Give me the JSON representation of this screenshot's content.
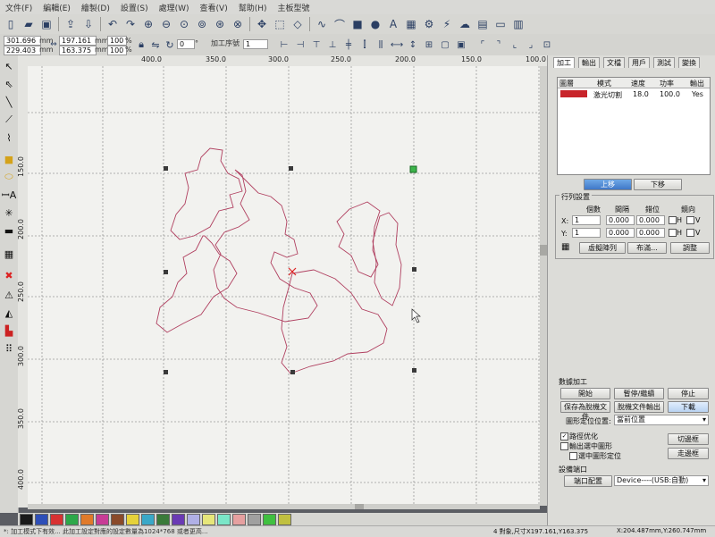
{
  "menu": [
    "文件(F)",
    "編輯(E)",
    "繪製(D)",
    "設置(S)",
    "處理(W)",
    "查看(V)",
    "幫助(H)",
    "主板型號"
  ],
  "toolbar2": {
    "pos_x": "301.696",
    "pos_y": "229.403",
    "unit_mm": "mm",
    "size_w": "197.161",
    "size_h": "163.375",
    "scale_x": "100",
    "scale_y": "100",
    "percent": "%",
    "angle": "0",
    "degree": "°",
    "order_label": "加工序號",
    "order_value": "1"
  },
  "ruler": {
    "h_ticks": [
      "400.0",
      "350.0",
      "300.0",
      "250.0",
      "200.0",
      "150.0",
      "100.0"
    ],
    "v_ticks": [
      "150.0",
      "200.0",
      "250.0",
      "300.0",
      "350.0",
      "400.0"
    ]
  },
  "palette": [
    "#1a1a1a",
    "#2e4fb8",
    "#d83232",
    "#2da84a",
    "#e07a2a",
    "#c83c96",
    "#8a4a2a",
    "#e6d23a",
    "#3aa8c8",
    "#3a7a3a",
    "#6a3ab4",
    "#b0b0e6",
    "#e6e67a",
    "#7ae6c8",
    "#e6a0a0",
    "#a0a0a0",
    "#40c040",
    "#c0c040"
  ],
  "status": {
    "left": "*: 加工模式下有效...  此加工設定對應的設定數量為1024*768 或者更高...",
    "right": "4 對象,尺寸X197.161,Y163.375",
    "coords": "X:204.487mm,Y:260.747mm"
  },
  "panel": {
    "tabs": [
      "加工",
      "輸出",
      "文檔",
      "用戶",
      "測試",
      "變換"
    ],
    "layer_headers": [
      "圖層",
      "模式",
      "速度",
      "功率",
      "輸出"
    ],
    "layer_rows": [
      {
        "color": "#c8242a",
        "mode": "激光切割",
        "speed": "18.0",
        "power": "100.0",
        "output": "Yes"
      }
    ],
    "btn_up": "上移",
    "btn_down": "下移",
    "array_title": "行列設置",
    "array_headers": [
      "個數",
      "間隔",
      "錯位",
      "鏡向"
    ],
    "row_x": {
      "label": "X:",
      "count": "1",
      "gap": "0.000",
      "offset": "0.000"
    },
    "row_y": {
      "label": "Y:",
      "count": "1",
      "gap": "0.000",
      "offset": "0.000"
    },
    "mirror_h": "H",
    "mirror_v": "V",
    "btn_virtual": "虛擬陣列",
    "btn_layout": "布滿...",
    "btn_adjust": "調整",
    "process_title": "數據加工",
    "btn_start": "開始",
    "btn_pause": "暫停/繼續",
    "btn_stop": "停止",
    "btn_save_offline": "保存為脫機文件",
    "btn_offline_output": "脫機文件輸出",
    "btn_download": "下載",
    "position_label": "圖形定位位置:",
    "position_value": "當前位置",
    "opt_path": "路徑优化",
    "opt_selected": "輸出選中圖形",
    "opt_selected_pos": "選中圖形定位",
    "btn_cut_frame": "切邊框",
    "btn_walk_frame": "走邊框",
    "port_title": "設備端口",
    "btn_port": "端口配置",
    "port_value": "Device----(USB:自動)"
  }
}
